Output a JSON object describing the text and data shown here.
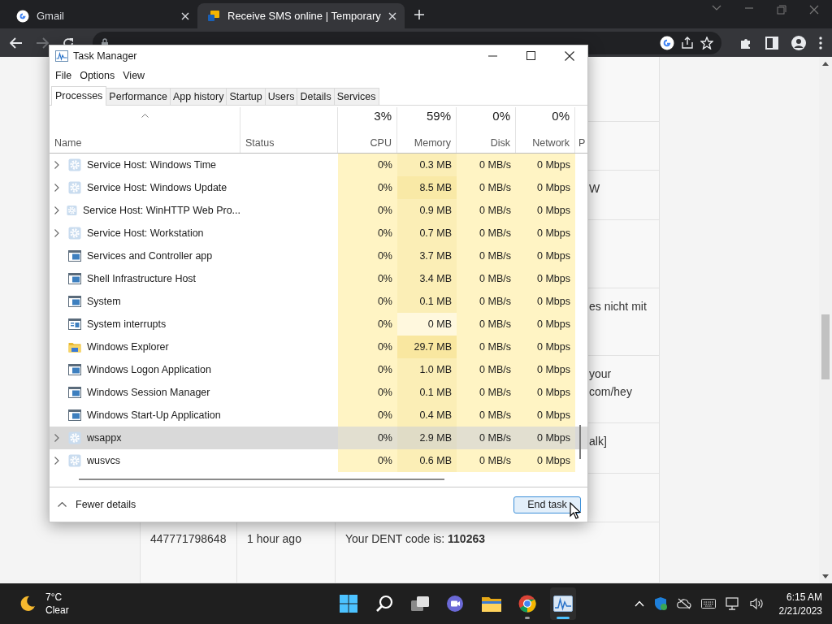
{
  "browser": {
    "tabs": [
      {
        "title": "Gmail",
        "kind": "google",
        "selected": false
      },
      {
        "title": "Receive SMS online | Temporary",
        "kind": "sms",
        "selected": true
      }
    ]
  },
  "page": {
    "rows": [
      {
        "kind": "blank"
      },
      {
        "kind": "blank"
      },
      {
        "kind": "blank"
      },
      {
        "kind": "fragment",
        "lines": [
          "W"
        ]
      },
      {
        "kind": "blank"
      },
      {
        "kind": "fragment",
        "lines": [
          "es nicht mit"
        ]
      },
      {
        "kind": "fragment",
        "lines": [
          "your",
          "com/hey"
        ]
      },
      {
        "kind": "fragment",
        "lines": [
          "alk]"
        ]
      },
      {
        "kind": "blank"
      },
      {
        "kind": "full",
        "number": "447771798648",
        "time": "1 hour ago",
        "message": "Your DENT code is: **110263**"
      }
    ]
  },
  "task_manager": {
    "title": "Task Manager",
    "menu": [
      "File",
      "Options",
      "View"
    ],
    "tabs": [
      {
        "label": "Processes",
        "selected": true
      },
      {
        "label": "Performance",
        "selected": false
      },
      {
        "label": "App history",
        "selected": false
      },
      {
        "label": "Startup",
        "selected": false
      },
      {
        "label": "Users",
        "selected": false
      },
      {
        "label": "Details",
        "selected": false
      },
      {
        "label": "Services",
        "selected": false
      }
    ],
    "columns": [
      {
        "kind": "name",
        "label": "Name"
      },
      {
        "kind": "status",
        "label": "Status"
      },
      {
        "kind": "metric",
        "label": "CPU",
        "total": "3%"
      },
      {
        "kind": "metric",
        "label": "Memory",
        "total": "59%"
      },
      {
        "kind": "metric",
        "label": "Disk",
        "total": "0%"
      },
      {
        "kind": "metric",
        "label": "Network",
        "total": "0%"
      },
      {
        "kind": "cut",
        "label": "P"
      }
    ],
    "processes": [
      {
        "name": "Service Host: Windows Time",
        "kind": "gear",
        "expandable": true,
        "selected": false,
        "cpu": "0%",
        "memory": {
          "value": "0.3 MB",
          "color": "#fbeeb6"
        },
        "disk": "0 MB/s",
        "network": "0 Mbps"
      },
      {
        "name": "Service Host: Windows Update",
        "kind": "gear",
        "expandable": true,
        "selected": false,
        "cpu": "0%",
        "memory": {
          "value": "8.5 MB",
          "color": "#f9e9a6"
        },
        "disk": "0 MB/s",
        "network": "0 Mbps"
      },
      {
        "name": "Service Host: WinHTTP Web Pro...",
        "kind": "gear",
        "expandable": true,
        "selected": false,
        "cpu": "0%",
        "memory": {
          "value": "0.9 MB",
          "color": "#fbeeb6"
        },
        "disk": "0 MB/s",
        "network": "0 Mbps"
      },
      {
        "name": "Service Host: Workstation",
        "kind": "gear",
        "expandable": true,
        "selected": false,
        "cpu": "0%",
        "memory": {
          "value": "0.7 MB",
          "color": "#fbeeb6"
        },
        "disk": "0 MB/s",
        "network": "0 Mbps"
      },
      {
        "name": "Services and Controller app",
        "kind": "window",
        "expandable": false,
        "selected": false,
        "cpu": "0%",
        "memory": {
          "value": "3.7 MB",
          "color": "#fbeeb6"
        },
        "disk": "0 MB/s",
        "network": "0 Mbps"
      },
      {
        "name": "Shell Infrastructure Host",
        "kind": "window",
        "expandable": false,
        "selected": false,
        "cpu": "0%",
        "memory": {
          "value": "3.4 MB",
          "color": "#fbeeb6"
        },
        "disk": "0 MB/s",
        "network": "0 Mbps"
      },
      {
        "name": "System",
        "kind": "window",
        "expandable": false,
        "selected": false,
        "cpu": "0%",
        "memory": {
          "value": "0.1 MB",
          "color": "#fbeeb6"
        },
        "disk": "0 MB/s",
        "network": "0 Mbps"
      },
      {
        "name": "System interrupts",
        "kind": "interrupts",
        "expandable": false,
        "selected": false,
        "cpu": "0%",
        "memory": {
          "value": "0 MB",
          "color": "#fff8de"
        },
        "disk": "0 MB/s",
        "network": "0 Mbps"
      },
      {
        "name": "Windows Explorer",
        "kind": "folder",
        "expandable": false,
        "selected": false,
        "cpu": "0%",
        "memory": {
          "value": "29.7 MB",
          "color": "#f9e7a0"
        },
        "disk": "0 MB/s",
        "network": "0 Mbps"
      },
      {
        "name": "Windows Logon Application",
        "kind": "window",
        "expandable": false,
        "selected": false,
        "cpu": "0%",
        "memory": {
          "value": "1.0 MB",
          "color": "#fbeeb6"
        },
        "disk": "0 MB/s",
        "network": "0 Mbps"
      },
      {
        "name": "Windows Session Manager",
        "kind": "window",
        "expandable": false,
        "selected": false,
        "cpu": "0%",
        "memory": {
          "value": "0.1 MB",
          "color": "#fbeeb6"
        },
        "disk": "0 MB/s",
        "network": "0 Mbps"
      },
      {
        "name": "Windows Start-Up Application",
        "kind": "window",
        "expandable": false,
        "selected": false,
        "cpu": "0%",
        "memory": {
          "value": "0.4 MB",
          "color": "#fbeeb6"
        },
        "disk": "0 MB/s",
        "network": "0 Mbps"
      },
      {
        "name": "wsappx",
        "kind": "gear",
        "expandable": true,
        "selected": true,
        "cpu": "0%",
        "memory": {
          "value": "2.9 MB",
          "color": "#e0dcc6"
        },
        "disk": "0 MB/s",
        "network": "0 Mbps"
      },
      {
        "name": "wusvcs",
        "kind": "gear",
        "expandable": true,
        "selected": false,
        "cpu": "0%",
        "memory": {
          "value": "0.6 MB",
          "color": "#fbeeb6"
        },
        "disk": "0 MB/s",
        "network": "0 Mbps"
      }
    ],
    "details_toggle": "Fewer details",
    "end_task": "End task"
  },
  "taskbar": {
    "temperature": "7°C",
    "weather": "Clear",
    "apps": [
      {
        "kind": "start",
        "running": false,
        "active": false
      },
      {
        "kind": "search",
        "running": false,
        "active": false
      },
      {
        "kind": "taskview",
        "running": false,
        "active": false
      },
      {
        "kind": "chat",
        "running": false,
        "active": false
      },
      {
        "kind": "explorer",
        "running": false,
        "active": false
      },
      {
        "kind": "chrome",
        "running": true,
        "active": false
      },
      {
        "kind": "taskmanager",
        "running": true,
        "active": true
      }
    ],
    "time": "6:15 AM",
    "date": "2/21/2023"
  }
}
